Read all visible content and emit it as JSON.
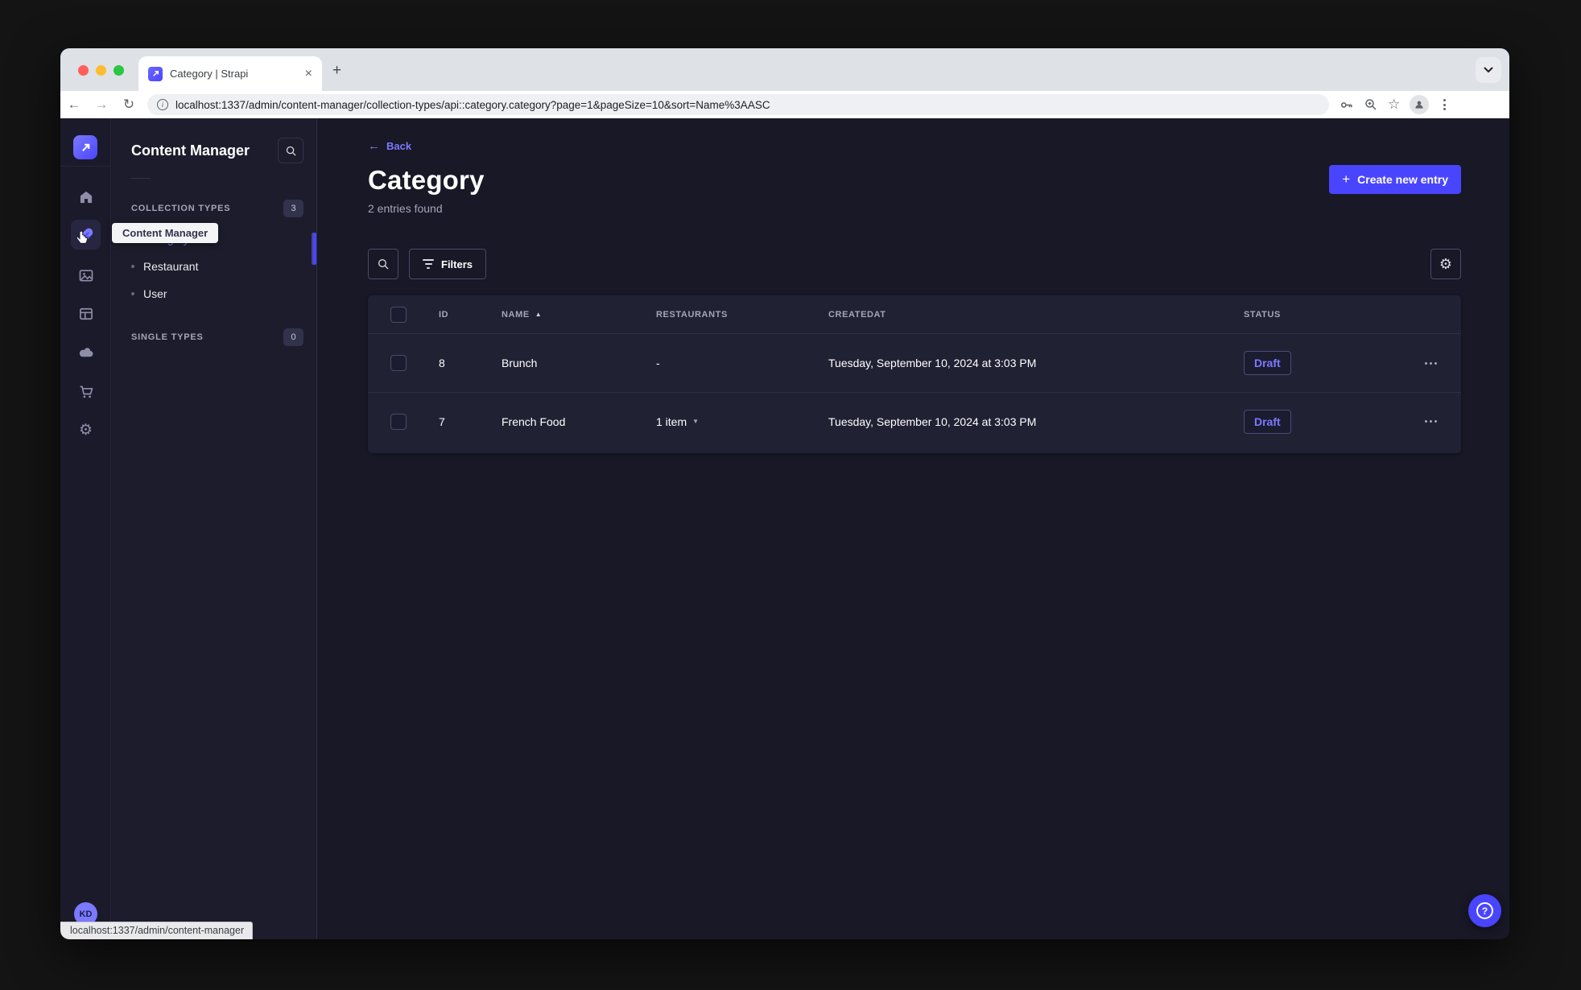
{
  "browser": {
    "tab_title": "Category | Strapi",
    "url": "localhost:1337/admin/content-manager/collection-types/api::category.category?page=1&pageSize=10&sort=Name%3AASC",
    "status_link": "localhost:1337/admin/content-manager"
  },
  "icons": {
    "back_arrow": "←",
    "forward_arrow": "→",
    "reload": "↻",
    "star": "☆",
    "close": "×",
    "plus": "+",
    "info": "i",
    "gear": "⚙",
    "sort_asc": "▲",
    "caret_down": "▼",
    "question": "?"
  },
  "rail": {
    "avatar_initials": "KD"
  },
  "subnav": {
    "title": "Content Manager",
    "tooltip": "Content Manager",
    "sections": [
      {
        "label": "COLLECTION TYPES",
        "count": "3"
      },
      {
        "label": "SINGLE TYPES",
        "count": "0"
      }
    ],
    "items": [
      {
        "label": "Category"
      },
      {
        "label": "Restaurant"
      },
      {
        "label": "User"
      }
    ]
  },
  "content": {
    "back_label": "Back",
    "title": "Category",
    "subtitle": "2 entries found",
    "create_button": "Create new entry",
    "filters_button": "Filters"
  },
  "table": {
    "columns": [
      "ID",
      "NAME",
      "RESTAURANTS",
      "CREATEDAT",
      "STATUS"
    ],
    "rows": [
      {
        "id": "8",
        "name": "Brunch",
        "restaurants": "-",
        "createdat": "Tuesday, September 10, 2024 at 3:03 PM",
        "status": "Draft"
      },
      {
        "id": "7",
        "name": "French Food",
        "restaurants": "1 item",
        "createdat": "Tuesday, September 10, 2024 at 3:03 PM",
        "status": "Draft"
      }
    ]
  },
  "colors": {
    "primary": "#4945ff",
    "primary_light": "#7b79ff",
    "app_bg": "#181826",
    "card_bg": "#212134",
    "border": "#2e2e48"
  }
}
